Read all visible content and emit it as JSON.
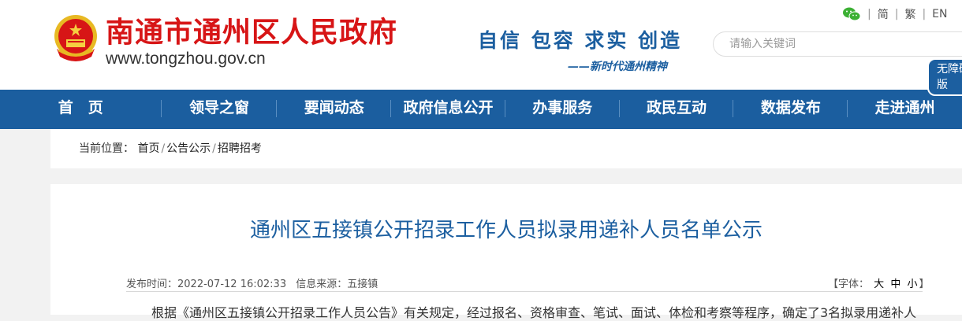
{
  "header": {
    "site_name": "南通市通州区人民政府",
    "site_url": "www.tongzhou.gov.cn",
    "slogan": "自信 包容 求实 创造",
    "slogan_sub": "——新时代通州精神",
    "top_links": [
      "简",
      "繁",
      "EN"
    ],
    "search_placeholder": "请输入关键词",
    "accessibility": "无障碍版"
  },
  "nav": {
    "items": [
      "首　页",
      "领导之窗",
      "要闻动态",
      "政府信息公开",
      "办事服务",
      "政民互动",
      "数据发布",
      "走进通州"
    ]
  },
  "breadcrumb": {
    "label": "当前位置：",
    "items": [
      "首页",
      "公告公示",
      "招聘招考"
    ]
  },
  "article": {
    "title": "通州区五接镇公开招录工作人员拟录用递补人员名单公示",
    "publish_label": "发布时间：",
    "publish_time": "2022-07-12 16:02:33",
    "source_label": "信息来源：",
    "source": "五接镇",
    "font_label": "【字体：",
    "font_sizes": [
      "大",
      "中",
      "小"
    ],
    "font_end": "】",
    "body": "根据《通州区五接镇公开招录工作人员公告》有关规定，经过报名、资格审查、笔试、面试、体检和考察等程序，确定了3名拟录用递补人"
  },
  "colors": {
    "brand_red": "#d71516",
    "brand_blue": "#1b5e9f"
  }
}
